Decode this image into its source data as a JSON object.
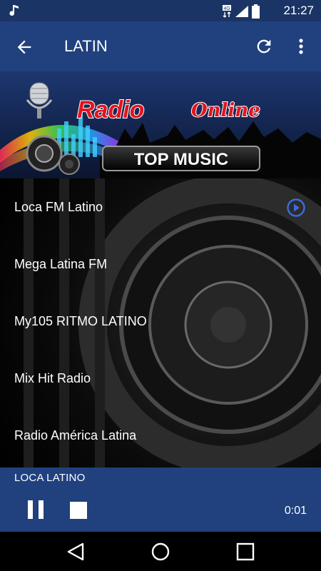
{
  "status_bar": {
    "time": "21:27",
    "network": "4G",
    "music_icon": "music-note-icon",
    "signal_icon": "signal-icon",
    "battery_icon": "battery-icon"
  },
  "app_bar": {
    "title": "LATIN",
    "back_icon": "arrow-back-icon",
    "refresh_icon": "refresh-icon",
    "more_icon": "more-vert-icon"
  },
  "banner": {
    "line1": "Radio",
    "line2": "Online",
    "line3": "TOP MUSIC"
  },
  "stations": [
    {
      "name": "Loca FM Latino",
      "playing": true
    },
    {
      "name": "Mega Latina FM",
      "playing": false
    },
    {
      "name": "My105 RITMO LATINO",
      "playing": false
    },
    {
      "name": "Mix Hit Radio",
      "playing": false
    },
    {
      "name": "Radio América Latina",
      "playing": false
    }
  ],
  "player": {
    "now_playing": "LOCA LATINO",
    "elapsed": "0:01",
    "pause_icon": "pause-icon",
    "stop_icon": "stop-icon"
  },
  "nav_bar": {
    "back": "nav-back-icon",
    "home": "nav-home-icon",
    "recents": "nav-recents-icon"
  },
  "colors": {
    "status_bar": "#1b3466",
    "app_bar": "#20417e",
    "player": "#20417e",
    "accent": "#3d6be0"
  }
}
